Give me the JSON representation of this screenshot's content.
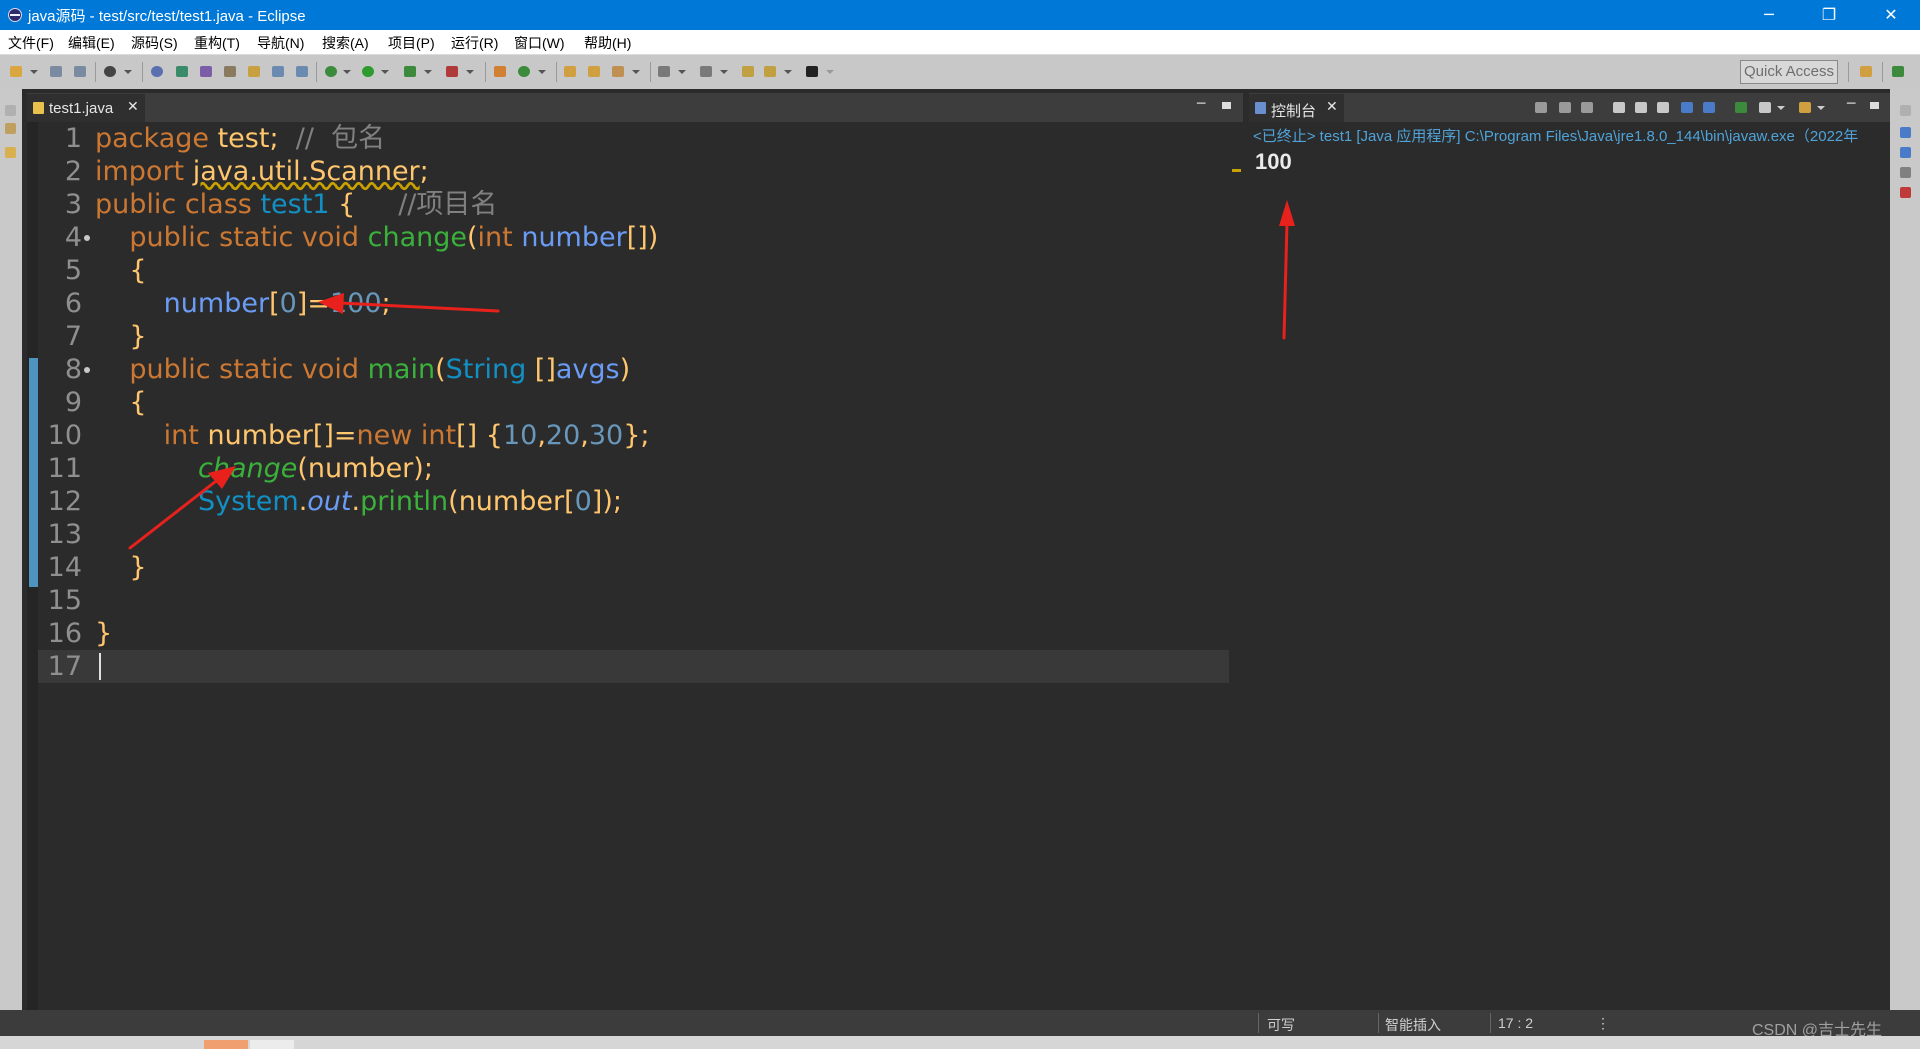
{
  "window": {
    "title": "java源码 - test/src/test/test1.java - Eclipse",
    "controls": {
      "minimize": "─",
      "restore": "❐",
      "close": "✕"
    }
  },
  "menu": {
    "items": [
      "文件(F)",
      "编辑(E)",
      "源码(S)",
      "重构(T)",
      "导航(N)",
      "搜索(A)",
      "项目(P)",
      "运行(R)",
      "窗口(W)",
      "帮助(H)"
    ]
  },
  "toolbar": {
    "quick_access_placeholder": "Quick Access"
  },
  "editor": {
    "tab_label": "test1.java",
    "tab_close": "✕",
    "lines": [
      {
        "n": "1",
        "text": "package test;  //  包名"
      },
      {
        "n": "2",
        "text": "import java.util.Scanner;"
      },
      {
        "n": "3",
        "text": "public class test1 {     //项目名"
      },
      {
        "n": "4",
        "text": "    public static void change(int number[])"
      },
      {
        "n": "5",
        "text": "    {"
      },
      {
        "n": "6",
        "text": "        number[0]=100;"
      },
      {
        "n": "7",
        "text": "    }"
      },
      {
        "n": "8",
        "text": "    public static void main(String []avgs)"
      },
      {
        "n": "9",
        "text": "    {"
      },
      {
        "n": "10",
        "text": "        int number[]=new int[] {10,20,30};"
      },
      {
        "n": "11",
        "text": "            change(number);"
      },
      {
        "n": "12",
        "text": "            System.out.println(number[0]);"
      },
      {
        "n": "13",
        "text": ""
      },
      {
        "n": "14",
        "text": "    }"
      },
      {
        "n": "15",
        "text": ""
      },
      {
        "n": "16",
        "text": "}"
      },
      {
        "n": "17",
        "text": ""
      }
    ]
  },
  "console": {
    "tab_label": "控制台",
    "tab_close": "✕",
    "header": "<已终止> test1 [Java 应用程序] C:\\Program Files\\Java\\jre1.8.0_144\\bin\\javaw.exe（2022年",
    "output": "100"
  },
  "status": {
    "writable": "可写",
    "insert_mode": "智能插入",
    "position": "17 : 2",
    "more": "⋮",
    "watermark": "CSDN @吉士先生"
  },
  "colors": {
    "title_bar": "#0078d7",
    "editor_bg": "#2b2b2b",
    "keyword": "#cc7832",
    "plain_code": "#ffc66d",
    "comment": "#808080",
    "class_name": "#1290c3",
    "method": "#3bb03b",
    "variable": "#6b9cf5",
    "number": "#6897bb",
    "console_header": "#4fa3d8",
    "annotation_arrow": "#e8211c"
  }
}
